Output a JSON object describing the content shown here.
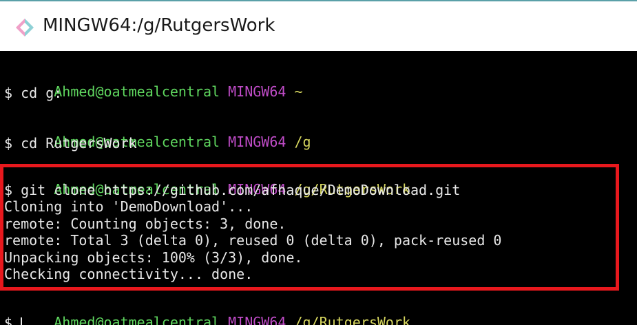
{
  "window": {
    "title": "MINGW64:/g/RutgersWork",
    "icon": "git-bash-icon",
    "accent_color": "#5aa0a8"
  },
  "terminal": {
    "colors": {
      "background": "#000000",
      "text": "#e8e8e8",
      "user_host": "#5fd75f",
      "system": "#c04cc8",
      "path": "#d7d75f",
      "highlight_box": "#e8181d"
    },
    "blocks": [
      {
        "user_host": "Ahmed@oatmealcentral",
        "system": "MINGW64",
        "path": "~",
        "command": "$ cd g:",
        "output": []
      },
      {
        "user_host": "Ahmed@oatmealcentral",
        "system": "MINGW64",
        "path": "/g",
        "command": "$ cd RutgersWork",
        "output": []
      },
      {
        "user_host": "Ahmed@oatmealcentral",
        "system": "MINGW64",
        "path": "/g/RutgersWork",
        "command": "$ git clone https://github.com/afhaque/DemoDownload.git",
        "output": [
          "Cloning into 'DemoDownload'...",
          "remote: Counting objects: 3, done.",
          "remote: Total 3 (delta 0), reused 0 (delta 0), pack-reused 0",
          "Unpacking objects: 100% (3/3), done.",
          "Checking connectivity... done."
        ]
      },
      {
        "user_host": "Ahmed@oatmealcentral",
        "system": "MINGW64",
        "path": "/g/RutgersWork",
        "command": "$ ",
        "output": []
      }
    ]
  }
}
